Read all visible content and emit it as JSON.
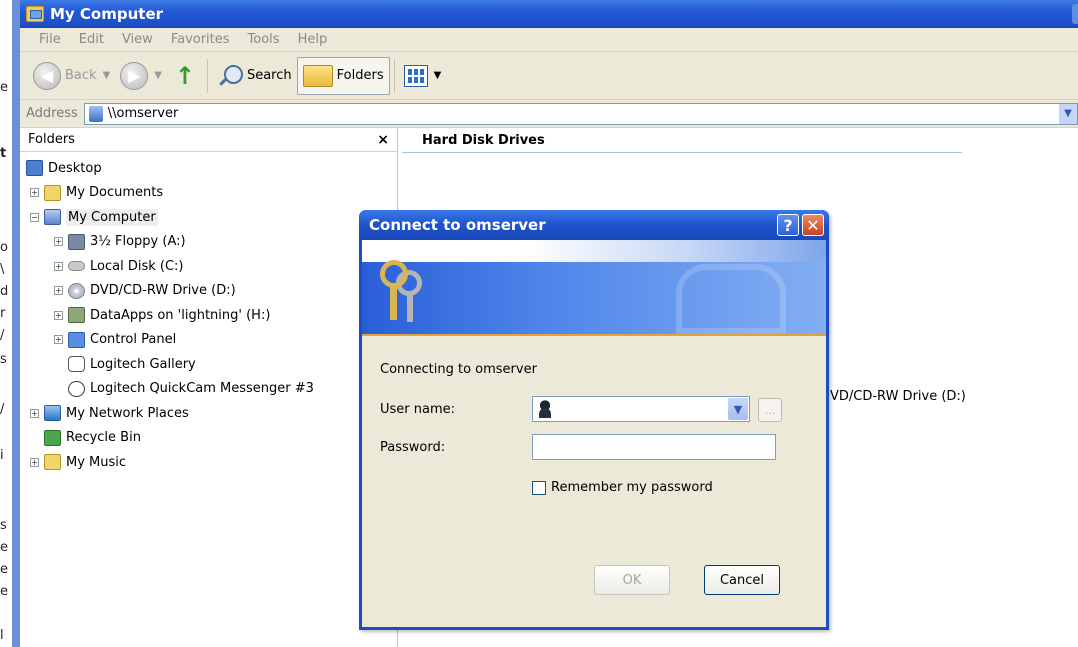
{
  "bg_window": {
    "edge_chars": [
      "e",
      "t",
      "o",
      "\\",
      "d",
      "r",
      "/",
      "s",
      "/",
      "i",
      "s",
      "e",
      "e",
      "e",
      "l"
    ]
  },
  "window": {
    "title": "My Computer",
    "title_icon": "my-computer-folder-icon"
  },
  "menu": [
    "File",
    "Edit",
    "View",
    "Favorites",
    "Tools",
    "Help"
  ],
  "toolbar": {
    "back_label": "Back",
    "search_label": "Search",
    "folders_label": "Folders"
  },
  "address": {
    "label": "Address",
    "value": "\\\\omserver"
  },
  "folders_pane": {
    "title": "Folders",
    "close": "×",
    "items": [
      {
        "label": "Desktop",
        "icon": "desktop-icon",
        "level": 0,
        "expander": ""
      },
      {
        "label": "My Documents",
        "icon": "my-documents-icon",
        "level": 1,
        "expander": "+"
      },
      {
        "label": "My Computer",
        "icon": "my-computer-icon",
        "level": 1,
        "expander": "−"
      },
      {
        "label": "3½ Floppy (A:)",
        "icon": "floppy-icon",
        "level": 2,
        "expander": "+"
      },
      {
        "label": "Local Disk (C:)",
        "icon": "local-disk-icon",
        "level": 2,
        "expander": "+"
      },
      {
        "label": "DVD/CD-RW Drive (D:)",
        "icon": "dvd-drive-icon",
        "level": 2,
        "expander": "+"
      },
      {
        "label": "DataApps on 'lightning' (H:)",
        "icon": "network-drive-icon",
        "level": 2,
        "expander": "+"
      },
      {
        "label": "Control Panel",
        "icon": "control-panel-icon",
        "level": 2,
        "expander": "+"
      },
      {
        "label": "Logitech Gallery",
        "icon": "logitech-gallery-icon",
        "level": 2,
        "expander": ""
      },
      {
        "label": "Logitech QuickCam Messenger #3",
        "icon": "webcam-icon",
        "level": 2,
        "expander": ""
      },
      {
        "label": "My Network Places",
        "icon": "network-places-icon",
        "level": 1,
        "expander": "+"
      },
      {
        "label": "Recycle Bin",
        "icon": "recycle-bin-icon",
        "level": 1,
        "expander": ""
      },
      {
        "label": "My Music",
        "icon": "my-music-icon",
        "level": 1,
        "expander": "+"
      }
    ]
  },
  "right_pane": {
    "section_title": "Hard Disk Drives",
    "partial_item": "VD/CD-RW Drive (D:)"
  },
  "dialog": {
    "title": "Connect to omserver",
    "help": "?",
    "close": "✕",
    "connecting_text": "Connecting to omserver",
    "username_label": "User name:",
    "password_label": "Password:",
    "browse_label": "...",
    "remember_label": "Remember my password",
    "ok_label": "OK",
    "cancel_label": "Cancel"
  }
}
